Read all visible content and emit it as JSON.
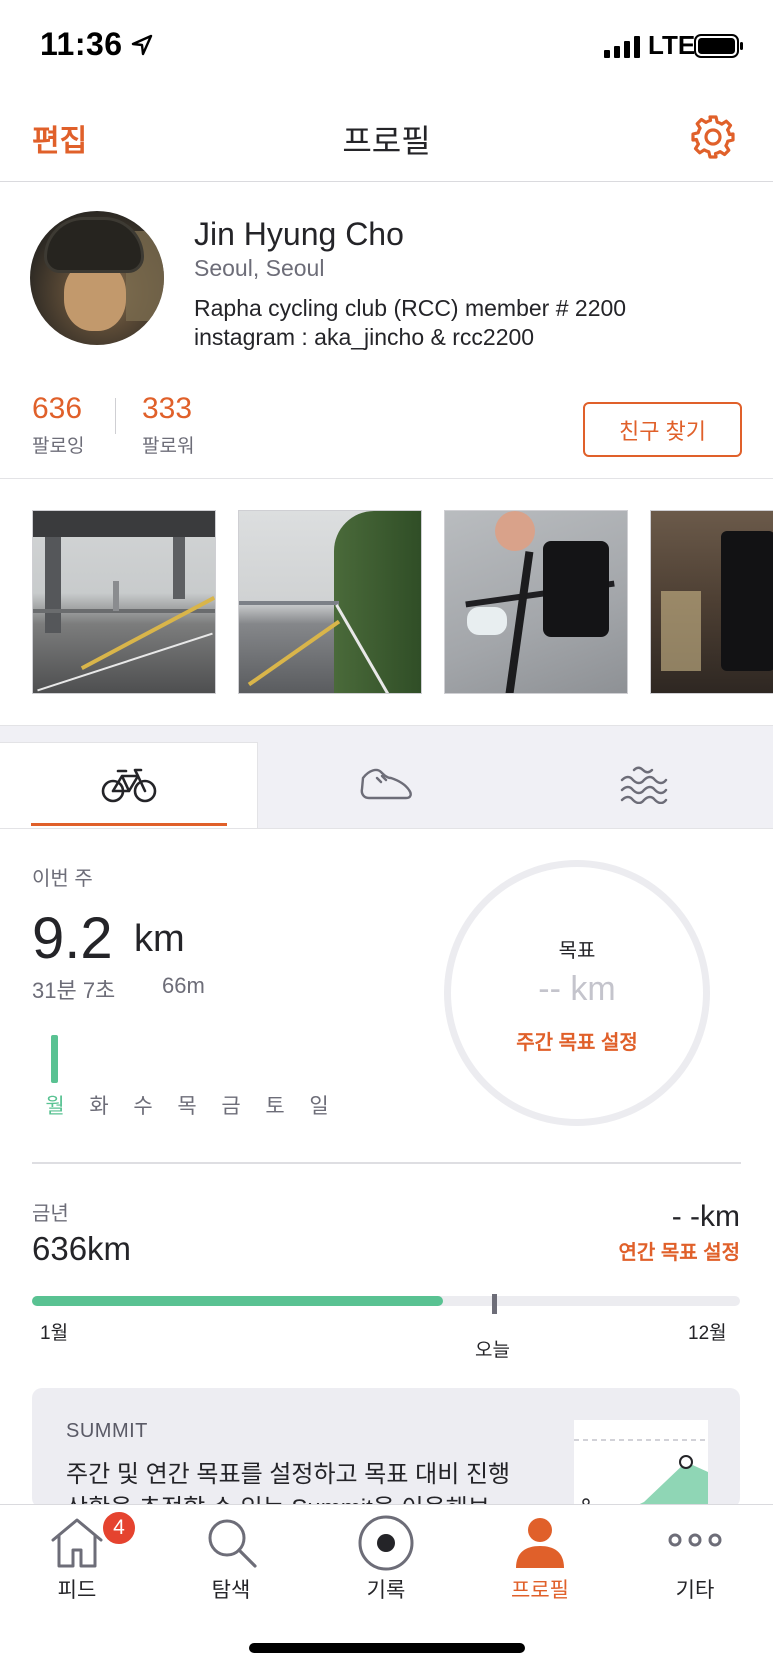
{
  "status_bar": {
    "time": "11:36",
    "network": "LTE"
  },
  "nav": {
    "edit_label": "편집",
    "title": "프로필",
    "settings_icon": "gear-icon"
  },
  "profile": {
    "name": "Jin Hyung Cho",
    "location": "Seoul, Seoul",
    "bio_line1": "Rapha cycling club (RCC) member # 2200",
    "bio_line2": "instagram : aka_jincho & rcc2200",
    "following_count": "636",
    "following_label": "팔로잉",
    "followers_count": "333",
    "followers_label": "팔로워",
    "find_friends_label": "친구 찾기"
  },
  "activity_tabs": [
    {
      "icon": "bike-icon",
      "active": true
    },
    {
      "icon": "shoe-icon",
      "active": false
    },
    {
      "icon": "waves-icon",
      "active": false
    }
  ],
  "weekly": {
    "label": "이번 주",
    "distance": "9.2",
    "distance_unit": "km",
    "time": "31분 7초",
    "elevation": "66m",
    "days": [
      "월",
      "화",
      "수",
      "목",
      "금",
      "토",
      "일"
    ],
    "active_day_index": 0,
    "goal_label": "목표",
    "goal_value": "-- km",
    "goal_set_label": "주간 목표 설정"
  },
  "yearly": {
    "label": "금년",
    "distance": "636km",
    "goal_value": "- -km",
    "goal_set_label": "연간 목표 설정",
    "progress_fraction": 0.58,
    "start_label": "1월",
    "today_label": "오늘",
    "end_label": "12월"
  },
  "summit": {
    "title": "SUMMIT",
    "text_line1": "주간 및 연간 목표를 설정하고 목표 대비 진행",
    "text_line2": "상황을 추적할 수 있는 Summit을 이용해보"
  },
  "tabbar": {
    "items": [
      {
        "label": "피드",
        "icon": "home-icon",
        "active": false,
        "badge": "4"
      },
      {
        "label": "탐색",
        "icon": "search-icon",
        "active": false
      },
      {
        "label": "기록",
        "icon": "record-icon",
        "active": false
      },
      {
        "label": "프로필",
        "icon": "profile-icon",
        "active": true
      },
      {
        "label": "기타",
        "icon": "more-icon",
        "active": false
      }
    ]
  },
  "colors": {
    "accent": "#e0602a",
    "progress": "#59c292",
    "badge": "#e5432f"
  }
}
